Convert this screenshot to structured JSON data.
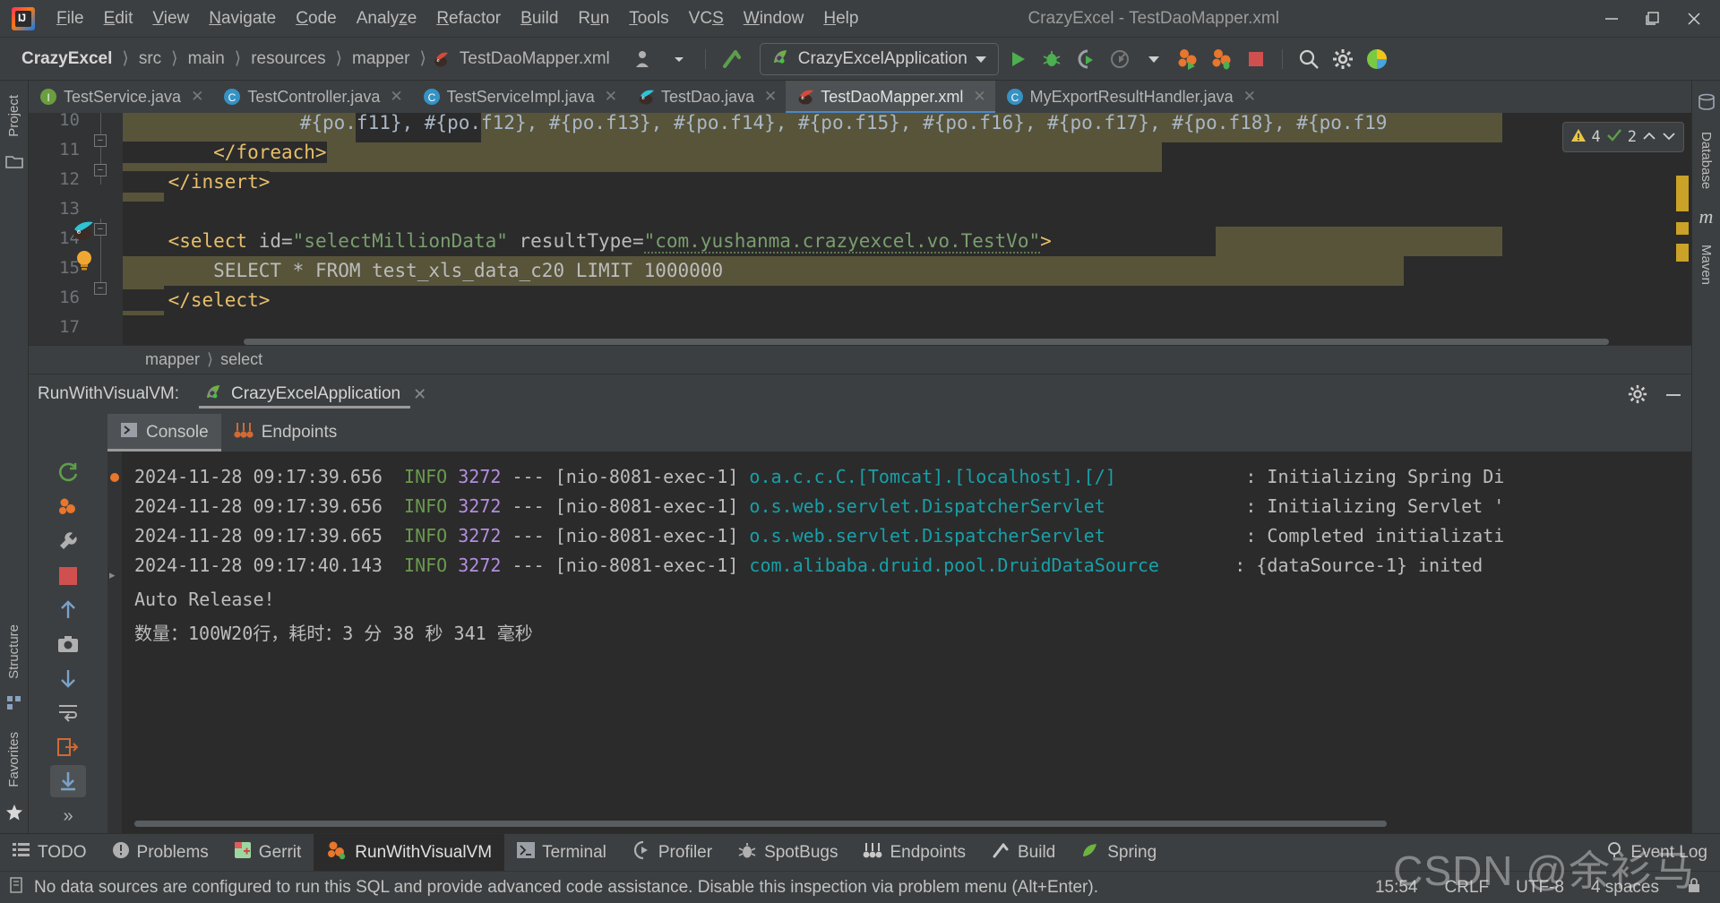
{
  "window": {
    "title": "CrazyExcel - TestDaoMapper.xml",
    "minimize": "─",
    "maximize": "❐",
    "close": "✕"
  },
  "menu": {
    "items": [
      {
        "label": "File",
        "mnemonic": "F"
      },
      {
        "label": "Edit",
        "mnemonic": "E"
      },
      {
        "label": "View",
        "mnemonic": "V"
      },
      {
        "label": "Navigate",
        "mnemonic": "N"
      },
      {
        "label": "Code",
        "mnemonic": "C"
      },
      {
        "label": "Analyze",
        "mnemonic": "z"
      },
      {
        "label": "Refactor",
        "mnemonic": "R"
      },
      {
        "label": "Build",
        "mnemonic": "B"
      },
      {
        "label": "Run",
        "mnemonic": "u"
      },
      {
        "label": "Tools",
        "mnemonic": "T"
      },
      {
        "label": "VCS",
        "mnemonic": "S"
      },
      {
        "label": "Window",
        "mnemonic": "W"
      },
      {
        "label": "Help",
        "mnemonic": "H"
      }
    ]
  },
  "navbar": {
    "breadcrumbs": [
      "CrazyExcel",
      "src",
      "main",
      "resources",
      "mapper",
      "TestDaoMapper.xml"
    ],
    "run_config": "CrazyExcelApplication",
    "icons": {
      "user_avatar": "user-icon",
      "dropdown": "▾",
      "build_hammer": "build-icon",
      "run": "run-icon",
      "debug": "debug-icon",
      "run_coverage": "run-with-coverage-icon",
      "profile": "profiler-icon",
      "visualvm_run": "visualvm-run-icon",
      "visualvm_debug": "visualvm-debug-icon",
      "stop": "stop-icon",
      "search": "search-icon",
      "settings": "gear-icon",
      "ide_ball": "ide-status-icon"
    }
  },
  "editor_tabs": [
    {
      "label": "TestService.java",
      "icon": "interface-icon",
      "icon_letter": "I",
      "icon_color": "#6a9e3f",
      "active": false
    },
    {
      "label": "TestController.java",
      "icon": "class-icon",
      "icon_letter": "C",
      "icon_color": "#3592c4",
      "active": false
    },
    {
      "label": "TestServiceImpl.java",
      "icon": "class-icon",
      "icon_letter": "C",
      "icon_color": "#3592c4",
      "active": false
    },
    {
      "label": "TestDao.java",
      "icon": "mybatis-dao-icon",
      "icon_letter": "",
      "icon_color": "#2ec4d6",
      "active": false
    },
    {
      "label": "TestDaoMapper.xml",
      "icon": "mybatis-mapper-icon",
      "icon_letter": "",
      "icon_color": "#d64a3a",
      "active": true
    },
    {
      "label": "MyExportResultHandler.java",
      "icon": "class-icon",
      "icon_letter": "C",
      "icon_color": "#3592c4",
      "active": false
    }
  ],
  "editor": {
    "line_numbers": [
      "10",
      "11",
      "12",
      "13",
      "14",
      "15",
      "16",
      "17"
    ],
    "lines": [
      {
        "no": "10",
        "text": "            #{po.f11}, #{po.f12}, #{po.f13}, #{po.f14}, #{po.f15}, #{po.f16}, #{po.f17}, #{po.f18}, #{po.f19"
      },
      {
        "no": "11",
        "text": "        </foreach>"
      },
      {
        "no": "12",
        "text": "    </insert>"
      },
      {
        "no": "13",
        "text": ""
      },
      {
        "no": "14",
        "text": "    <select id=\"selectMillionData\" resultType=\"com.yushanma.crazyexcel.vo.TestVo\">"
      },
      {
        "no": "15",
        "text": "        SELECT * FROM test_xls_data_c20 LIMIT 1000000"
      },
      {
        "no": "16",
        "text": "    </select>"
      },
      {
        "no": "17",
        "text": ""
      }
    ],
    "select_tag": {
      "open": "<select ",
      "attr_id": "id=",
      "val_id": "\"selectMillionData\"",
      "attr_type": " resultType=",
      "val_type": "\"com.yushanma.crazyexcel.vo.TestVo\"",
      "close": ">"
    },
    "sql_line": "SELECT * FROM test_xls_data_c20 LIMIT 1000000",
    "inspection": {
      "warnings": "4",
      "checks": "2",
      "warn_icon": "warning-triangle-icon",
      "ok_icon": "checkmark-icon",
      "up": "⌃",
      "down": "⌄"
    },
    "breadcrumbs": [
      "mapper",
      "select"
    ]
  },
  "tool_window": {
    "title": "RunWithVisualVM:",
    "tab": "CrazyExcelApplication",
    "subtabs": [
      {
        "label": "Console",
        "icon": "console-icon",
        "active": true
      },
      {
        "label": "Endpoints",
        "icon": "endpoints-icon",
        "active": false
      }
    ],
    "controls": {
      "settings": "gear-icon",
      "hide": "─"
    },
    "gutter_buttons": [
      "rerun-icon",
      "thread-dump-icon",
      "stop-icon",
      "scroll-up-icon",
      "scroll-down-icon",
      "camera-icon",
      "print-icon",
      "soft-wrap-icon",
      "exit-icon",
      "scroll-end-icon"
    ]
  },
  "console": {
    "lines": [
      {
        "type": "log",
        "time": "2024-11-28 09:17:39.656",
        "level": "INFO",
        "pid": "3272",
        "dashes": "---",
        "thread": "[nio-8081-exec-1]",
        "logger": "o.a.c.c.C.[Tomcat].[localhost].[/]",
        "sep": ":",
        "message": "Initializing Spring Di"
      },
      {
        "type": "log",
        "time": "2024-11-28 09:17:39.656",
        "level": "INFO",
        "pid": "3272",
        "dashes": "---",
        "thread": "[nio-8081-exec-1]",
        "logger": "o.s.web.servlet.DispatcherServlet",
        "sep": ":",
        "message": "Initializing Servlet '"
      },
      {
        "type": "log",
        "time": "2024-11-28 09:17:39.665",
        "level": "INFO",
        "pid": "3272",
        "dashes": "---",
        "thread": "[nio-8081-exec-1]",
        "logger": "o.s.web.servlet.DispatcherServlet",
        "sep": ":",
        "message": "Completed initializati"
      },
      {
        "type": "log",
        "time": "2024-11-28 09:17:40.143",
        "level": "INFO",
        "pid": "3272",
        "dashes": "---",
        "thread": "[nio-8081-exec-1]",
        "logger": "com.alibaba.druid.pool.DruidDataSource",
        "sep": ":",
        "message": "{dataSource-1} inited"
      },
      {
        "type": "plain",
        "text": "Auto Release!"
      },
      {
        "type": "plain",
        "text": "数量：100W20行，耗时：3 分 38 秒 341 毫秒"
      }
    ]
  },
  "left_strip": {
    "items": [
      {
        "label": "Project",
        "icon": "project-icon"
      },
      {
        "label": "Structure",
        "icon": "structure-icon"
      },
      {
        "label": "Favorites",
        "icon": "favorites-icon"
      }
    ]
  },
  "right_strip": {
    "items": [
      {
        "label": "Database",
        "icon": "database-icon"
      },
      {
        "label": "Maven",
        "icon": "maven-icon"
      }
    ]
  },
  "bottom_bar": {
    "items": [
      {
        "label": "TODO",
        "icon": "todo-icon",
        "active": false
      },
      {
        "label": "Problems",
        "icon": "problems-icon",
        "active": false
      },
      {
        "label": "Gerrit",
        "icon": "gerrit-icon",
        "active": false
      },
      {
        "label": "RunWithVisualVM",
        "icon": "visualvm-icon",
        "active": true
      },
      {
        "label": "Terminal",
        "icon": "terminal-icon",
        "active": false
      },
      {
        "label": "Profiler",
        "icon": "profiler-icon",
        "active": false
      },
      {
        "label": "SpotBugs",
        "icon": "spotbugs-icon",
        "active": false
      },
      {
        "label": "Endpoints",
        "icon": "endpoints-icon",
        "active": false
      },
      {
        "label": "Build",
        "icon": "build-icon",
        "active": false
      },
      {
        "label": "Spring",
        "icon": "spring-icon",
        "active": false
      }
    ],
    "event_log": {
      "label": "Event Log",
      "icon": "event-log-icon"
    }
  },
  "status_bar": {
    "message": "No data sources are configured to run this SQL and provide advanced code assistance. Disable this inspection via problem menu (Alt+Enter).",
    "icon": "info-icon",
    "time": "15:54",
    "line_separator": "CRLF",
    "encoding": "UTF-8",
    "indent": "4 spaces",
    "lock": "lock-icon"
  },
  "watermark": "CSDN @余衫马",
  "colors": {
    "bg": "#3c3f41",
    "editor_bg": "#2b2b2b",
    "accent_blue": "#4a88c7",
    "highlight_band": "#57543a",
    "string_green": "#7a9e6e",
    "tag_orange": "#e8bf6a",
    "logger_teal": "#18a0a8",
    "info_green": "#6a9a4e",
    "pid_purple": "#b38ee0"
  }
}
